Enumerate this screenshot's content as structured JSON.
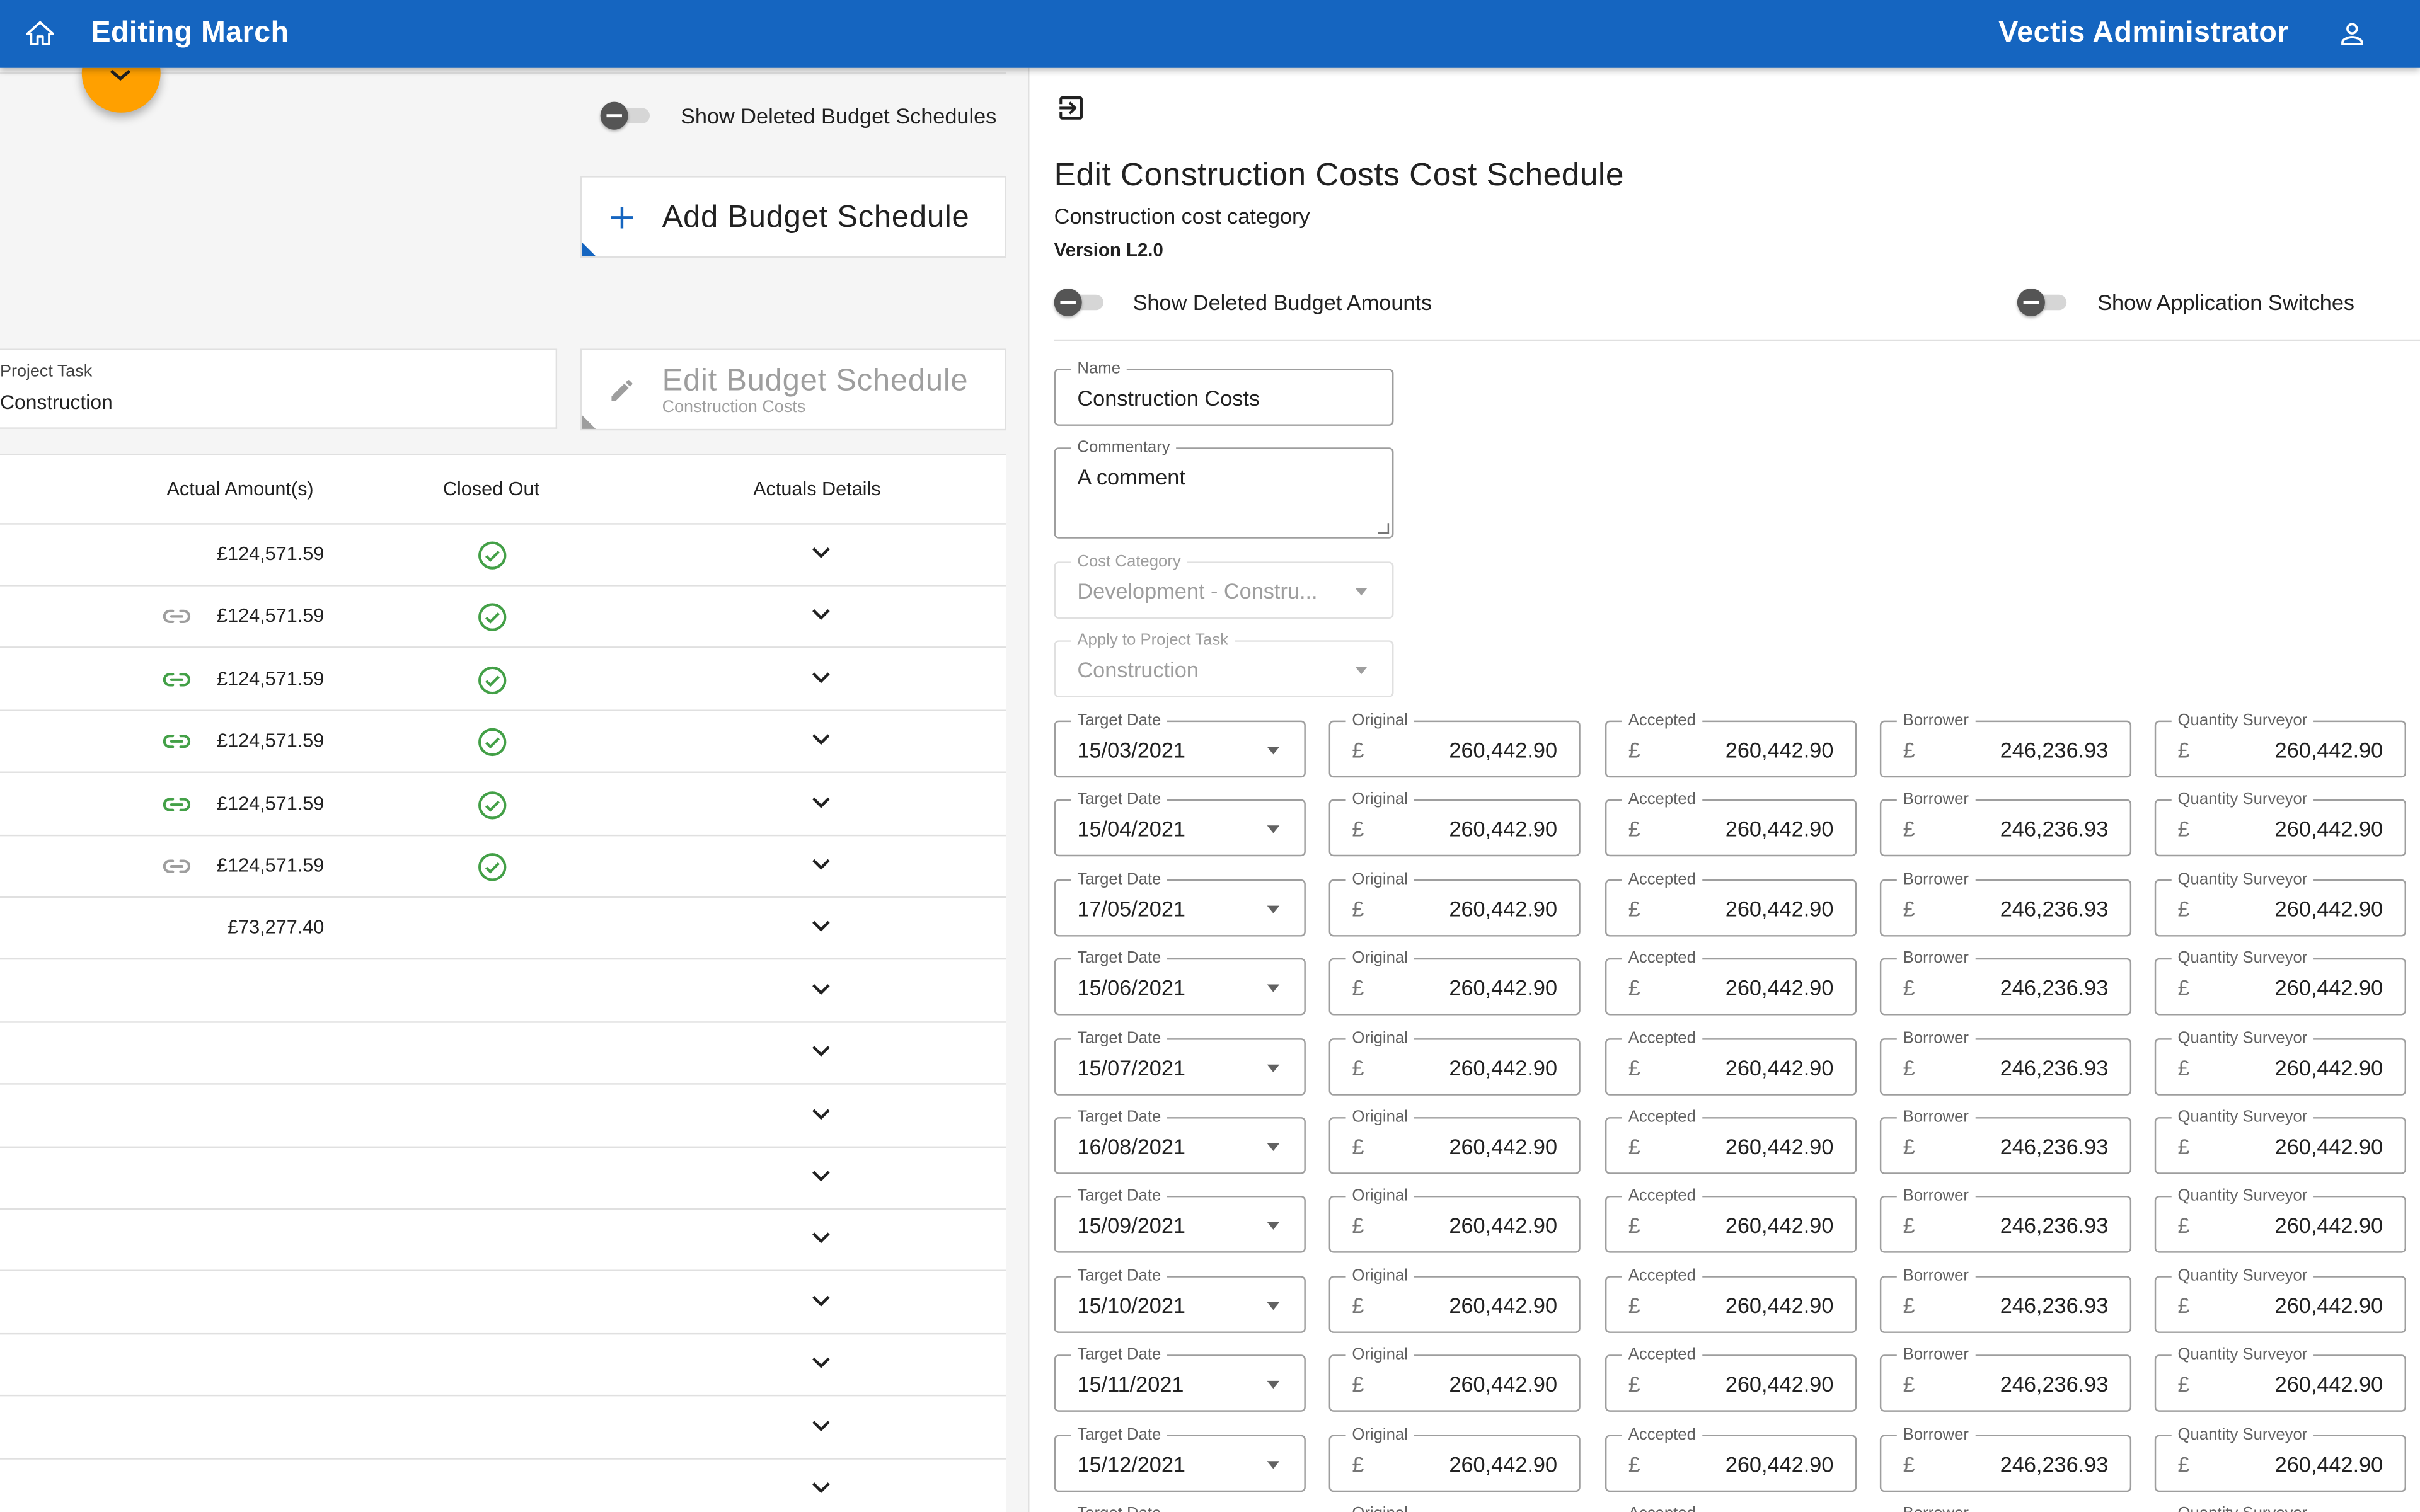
{
  "header": {
    "title": "Editing March",
    "user": "Vectis Administrator"
  },
  "left": {
    "toggle_label": "Show Deleted Budget Schedules",
    "add_button": "Add Budget Schedule",
    "edit_button": "Edit Budget Schedule",
    "edit_button_sub": "Construction Costs",
    "project_task_label": "Project Task",
    "project_task_value": "Construction",
    "table": {
      "columns": [
        "Actual Amount(s)",
        "Closed Out",
        "Actuals Details"
      ],
      "rows": [
        {
          "amount": "£124,571.59",
          "link": "none",
          "closed": true
        },
        {
          "amount": "£124,571.59",
          "link": "grey",
          "closed": true
        },
        {
          "amount": "£124,571.59",
          "link": "green",
          "closed": true
        },
        {
          "amount": "£124,571.59",
          "link": "green",
          "closed": true
        },
        {
          "amount": "£124,571.59",
          "link": "green",
          "closed": true
        },
        {
          "amount": "£124,571.59",
          "link": "grey",
          "closed": true
        },
        {
          "amount": "£73,277.40",
          "link": "none",
          "closed": false
        },
        {
          "amount": "",
          "link": "none",
          "closed": false
        },
        {
          "amount": "",
          "link": "none",
          "closed": false
        },
        {
          "amount": "",
          "link": "none",
          "closed": false
        },
        {
          "amount": "",
          "link": "none",
          "closed": false
        },
        {
          "amount": "",
          "link": "none",
          "closed": false
        },
        {
          "amount": "",
          "link": "none",
          "closed": false
        },
        {
          "amount": "",
          "link": "none",
          "closed": false
        },
        {
          "amount": "",
          "link": "none",
          "closed": false
        },
        {
          "amount": "",
          "link": "none",
          "closed": false
        }
      ]
    }
  },
  "right": {
    "title": "Edit Construction Costs Cost Schedule",
    "subtitle": "Construction cost category",
    "version": "Version L2.0",
    "toggle_amounts": "Show Deleted Budget Amounts",
    "toggle_switches": "Show Application Switches",
    "name_label": "Name",
    "name_value": "Construction Costs",
    "commentary_label": "Commentary",
    "commentary_value": "A comment",
    "cost_category_label": "Cost Category",
    "cost_category_value": "Development - Constru...",
    "apply_task_label": "Apply to Project Task",
    "apply_task_value": "Construction",
    "col_labels": {
      "date": "Target Date",
      "original": "Original",
      "accepted": "Accepted",
      "borrower": "Borrower",
      "qs": "Quantity Surveyor"
    },
    "currency": "£",
    "schedule": [
      {
        "date": "15/03/2021",
        "original": "260,442.90",
        "accepted": "260,442.90",
        "borrower": "246,236.93",
        "qs": "260,442.90"
      },
      {
        "date": "15/04/2021",
        "original": "260,442.90",
        "accepted": "260,442.90",
        "borrower": "246,236.93",
        "qs": "260,442.90"
      },
      {
        "date": "17/05/2021",
        "original": "260,442.90",
        "accepted": "260,442.90",
        "borrower": "246,236.93",
        "qs": "260,442.90"
      },
      {
        "date": "15/06/2021",
        "original": "260,442.90",
        "accepted": "260,442.90",
        "borrower": "246,236.93",
        "qs": "260,442.90"
      },
      {
        "date": "15/07/2021",
        "original": "260,442.90",
        "accepted": "260,442.90",
        "borrower": "246,236.93",
        "qs": "260,442.90"
      },
      {
        "date": "16/08/2021",
        "original": "260,442.90",
        "accepted": "260,442.90",
        "borrower": "246,236.93",
        "qs": "260,442.90"
      },
      {
        "date": "15/09/2021",
        "original": "260,442.90",
        "accepted": "260,442.90",
        "borrower": "246,236.93",
        "qs": "260,442.90"
      },
      {
        "date": "15/10/2021",
        "original": "260,442.90",
        "accepted": "260,442.90",
        "borrower": "246,236.93",
        "qs": "260,442.90"
      },
      {
        "date": "15/11/2021",
        "original": "260,442.90",
        "accepted": "260,442.90",
        "borrower": "246,236.93",
        "qs": "260,442.90"
      },
      {
        "date": "15/12/2021",
        "original": "260,442.90",
        "accepted": "260,442.90",
        "borrower": "246,236.93",
        "qs": "260,442.90"
      }
    ]
  },
  "colors": {
    "primary": "#1565c0",
    "accent": "#ffa000",
    "success": "#43a047"
  }
}
